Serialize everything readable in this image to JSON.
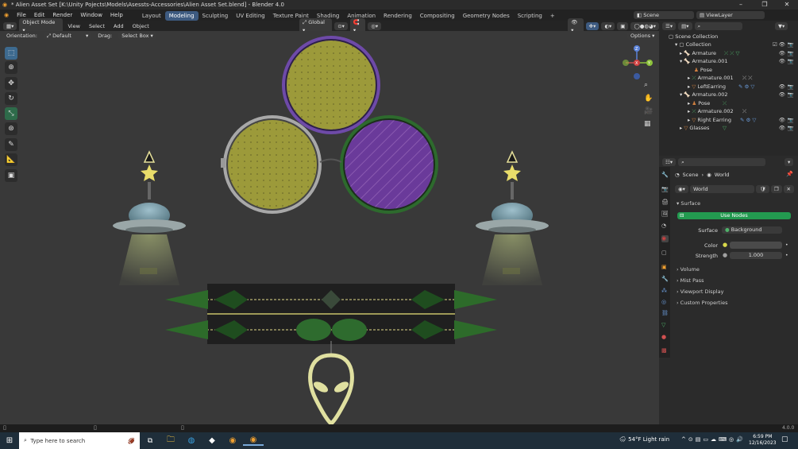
{
  "window": {
    "title": "* Alien Asset Set [K:\\Unity Pojects\\Models\\Asessts-Accessories\\Alien Asset Set.blend] - Blender 4.0",
    "min_icon": "minimize-icon",
    "max_icon": "maximize-icon",
    "close_icon": "close-icon"
  },
  "menu": {
    "file": "File",
    "edit": "Edit",
    "render": "Render",
    "window": "Window",
    "help": "Help"
  },
  "workspaces": [
    "Layout",
    "Modeling",
    "Sculpting",
    "UV Editing",
    "Texture Paint",
    "Shading",
    "Animation",
    "Rendering",
    "Compositing",
    "Geometry Nodes",
    "Scripting"
  ],
  "active_workspace": "Modeling",
  "scene": {
    "name": "Scene",
    "view_layer": "ViewLayer"
  },
  "viewport_header": {
    "mode": "Object Mode",
    "view": "View",
    "select": "Select",
    "add": "Add",
    "object": "Object",
    "transform": "Global",
    "options": "Options"
  },
  "subheader": {
    "orientation_label": "Orientation:",
    "orientation": "Default",
    "drag_label": "Drag:",
    "drag": "Select Box"
  },
  "gizmo": {
    "x": "X",
    "y": "Y",
    "z": "Z"
  },
  "outliner": {
    "header": "Scene Collection",
    "rows": [
      {
        "label": "Collection"
      },
      {
        "label": "Armature"
      },
      {
        "label": "Armature.001"
      },
      {
        "label": "Pose"
      },
      {
        "label": "Armature.001"
      },
      {
        "label": "LeftEarring"
      },
      {
        "label": "Armature.002"
      },
      {
        "label": "Pose"
      },
      {
        "label": "Armature.002"
      },
      {
        "label": "Right Earring"
      },
      {
        "label": "Glasses"
      }
    ]
  },
  "properties": {
    "breadcrumb_scene": "Scene",
    "breadcrumb_world": "World",
    "world_name": "World",
    "surface_header": "Surface",
    "use_nodes": "Use Nodes",
    "surface_label": "Surface",
    "surface_value": "Background",
    "color_label": "Color",
    "strength_label": "Strength",
    "strength_value": "1.000",
    "sections": [
      "Volume",
      "Mist Pass",
      "Viewport Display",
      "Custom Properties"
    ]
  },
  "statusbar": {
    "version": "4.0.0"
  },
  "taskbar": {
    "search_placeholder": "Type here to search",
    "weather": "54°F  Light rain",
    "time": "6:59 PM",
    "date": "12/16/2023"
  },
  "colors": {
    "accent": "#3d5a80",
    "use_nodes": "#239a50",
    "yellow_lens": "#9c9a3a",
    "purple_lens": "#6a3a9a"
  }
}
